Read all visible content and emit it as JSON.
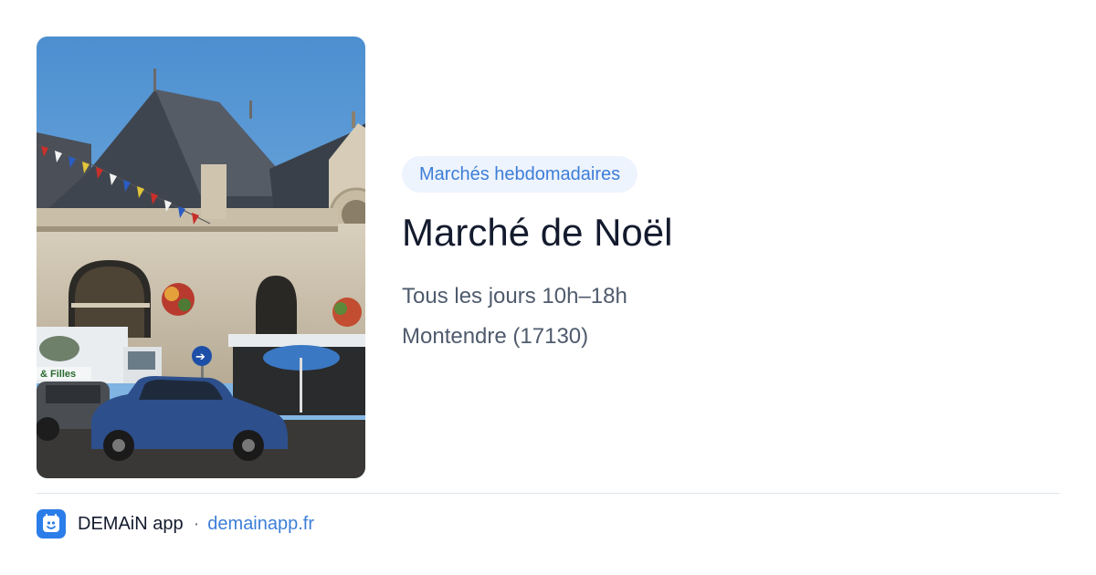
{
  "event": {
    "category": "Marchés hebdomadaires",
    "title": "Marché de Noël",
    "schedule": "Tous les jours 10h–18h",
    "location": "Montendre (17130)"
  },
  "photo": {
    "sign_text": "& Filles"
  },
  "footer": {
    "brand": "DEMAiN app",
    "separator": "·",
    "domain": "demainapp.fr",
    "icon": "demain-app-icon"
  },
  "colors": {
    "accent": "#3d7ed8",
    "badge_bg": "#eef4fd",
    "title": "#141b2e",
    "text": "#4f5b6d",
    "divider": "#dde5ec"
  }
}
